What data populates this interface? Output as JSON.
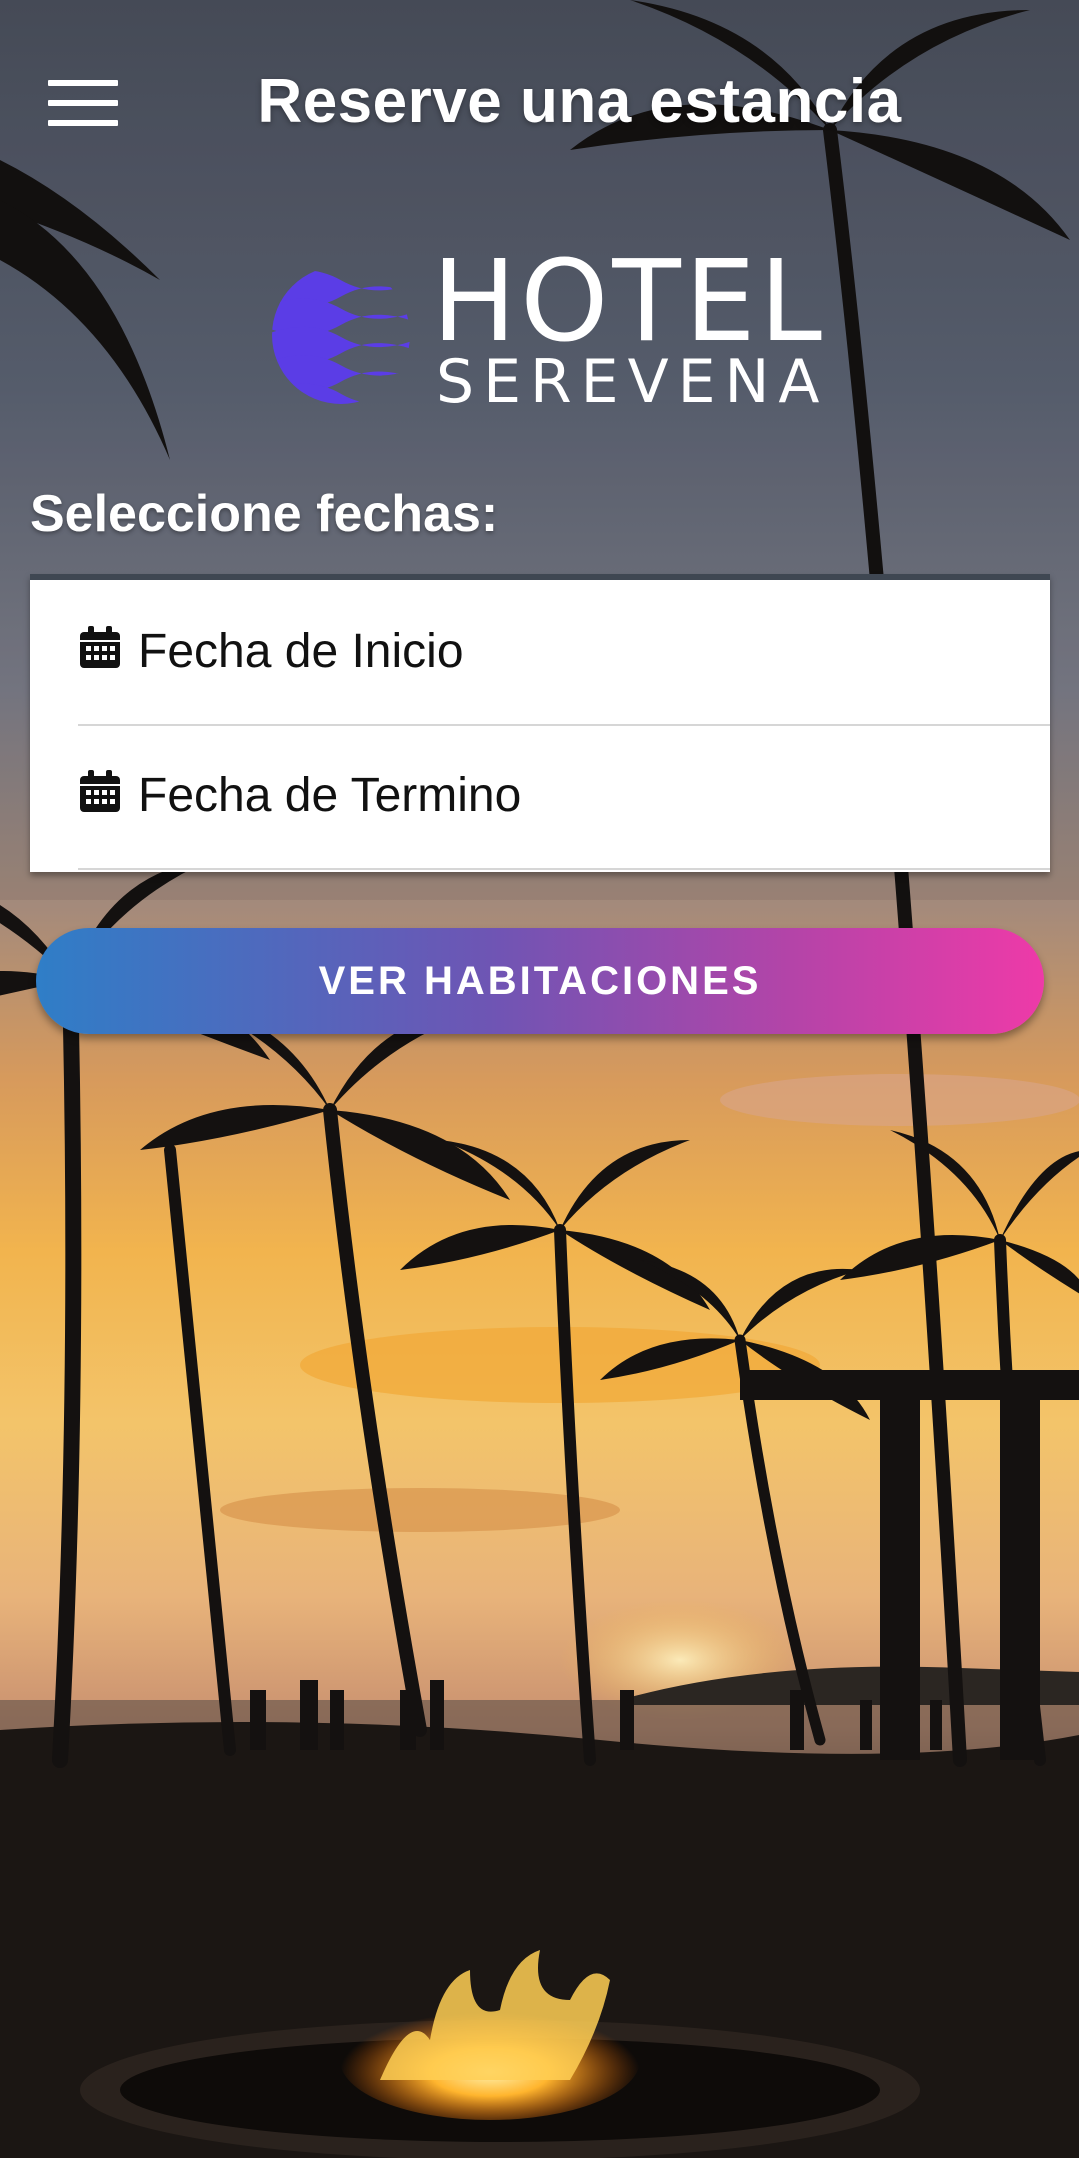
{
  "header": {
    "title": "Reserve una estancia",
    "menu_icon": "hamburger-menu-icon"
  },
  "logo": {
    "line1": "HOTEL",
    "line2": "SEREVENA",
    "mark_color": "#5b3de6"
  },
  "form": {
    "label": "Seleccione fechas:",
    "start_date": {
      "text": "Fecha de Inicio",
      "icon": "calendar-icon"
    },
    "end_date": {
      "text": "Fecha de Termino",
      "icon": "calendar-icon"
    }
  },
  "cta": {
    "label": "VER HABITACIONES",
    "gradient_start": "#2f7ec7",
    "gradient_end": "#ee3aa8"
  },
  "background": {
    "description_icon": "sunset-palms-background"
  }
}
